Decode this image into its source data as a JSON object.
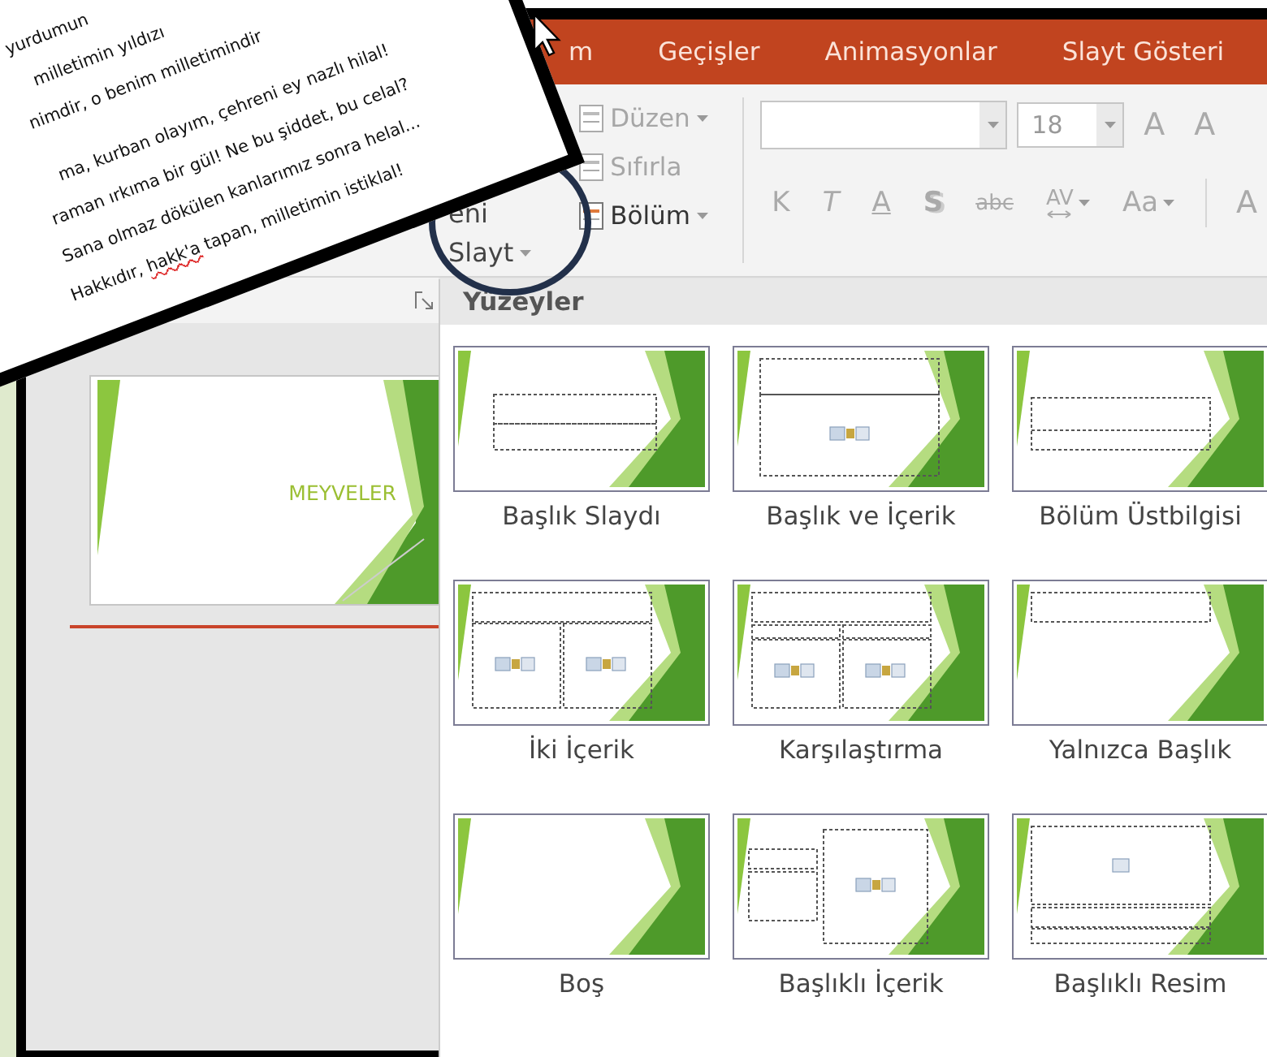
{
  "tabs": [
    {
      "label": "m"
    },
    {
      "label": "Geçişler"
    },
    {
      "label": "Animasyonlar"
    },
    {
      "label": "Slayt Gösteri"
    }
  ],
  "ribbon": {
    "new_slide": {
      "line1": "eni",
      "line2": "Slayt"
    },
    "slide_commands": [
      {
        "label": "Düzen",
        "caret": true,
        "disabled": true
      },
      {
        "label": "Sıfırla",
        "caret": false,
        "disabled": true
      },
      {
        "label": "Bölüm",
        "caret": true,
        "disabled": false
      }
    ],
    "font_size": "18",
    "grow_buttons": [
      "A",
      "A"
    ],
    "format_buttons": [
      {
        "label": "K",
        "kind": "plain"
      },
      {
        "label": "T",
        "kind": "italic"
      },
      {
        "label": "A",
        "kind": "underline"
      },
      {
        "label": "S",
        "kind": "shadow"
      },
      {
        "label": "abc",
        "kind": "strike"
      },
      {
        "label": "AV",
        "kind": "spacing"
      },
      {
        "label": "Aa",
        "kind": "case"
      }
    ],
    "cut_button": "A"
  },
  "slides_panel": {
    "slides": [
      {
        "title": "MEYVELER"
      }
    ]
  },
  "gallery": {
    "header": "Yüzeyler",
    "layouts": [
      {
        "label": "Başlık Slaydı",
        "kind": "title"
      },
      {
        "label": "Başlık ve İçerik",
        "kind": "title-content"
      },
      {
        "label": "Bölüm Üstbilgisi",
        "kind": "section"
      },
      {
        "label": "İki İçerik",
        "kind": "two-content"
      },
      {
        "label": "Karşılaştırma",
        "kind": "comparison"
      },
      {
        "label": "Yalnızca Başlık",
        "kind": "title-only"
      },
      {
        "label": "Boş",
        "kind": "blank"
      },
      {
        "label": "Başlıklı İçerik",
        "kind": "content-caption"
      },
      {
        "label": "Başlıklı Resim",
        "kind": "picture-caption"
      }
    ]
  },
  "note": {
    "stanzas": [
      [
        [
          {
            "text": "yurdumun"
          }
        ],
        [
          {
            "text": "milletimin yıldızı"
          }
        ],
        [
          {
            "text": "nimdir, o benim milletimindir"
          }
        ]
      ],
      [
        [
          {
            "text": "ma, kurban olayım, çehreni ey nazlı hilal!"
          }
        ],
        [
          {
            "text": "raman ırkıma bir gül! Ne bu şiddet, bu celal?"
          }
        ],
        [
          {
            "text": "Sana olmaz dökülen kanlarımız sonra helal..."
          }
        ],
        [
          {
            "text": "Hakkıdır, "
          },
          {
            "text": "hakk'a",
            "misspelled": true
          },
          {
            "text": " tapan, milletimin istiklal!"
          }
        ]
      ]
    ]
  }
}
